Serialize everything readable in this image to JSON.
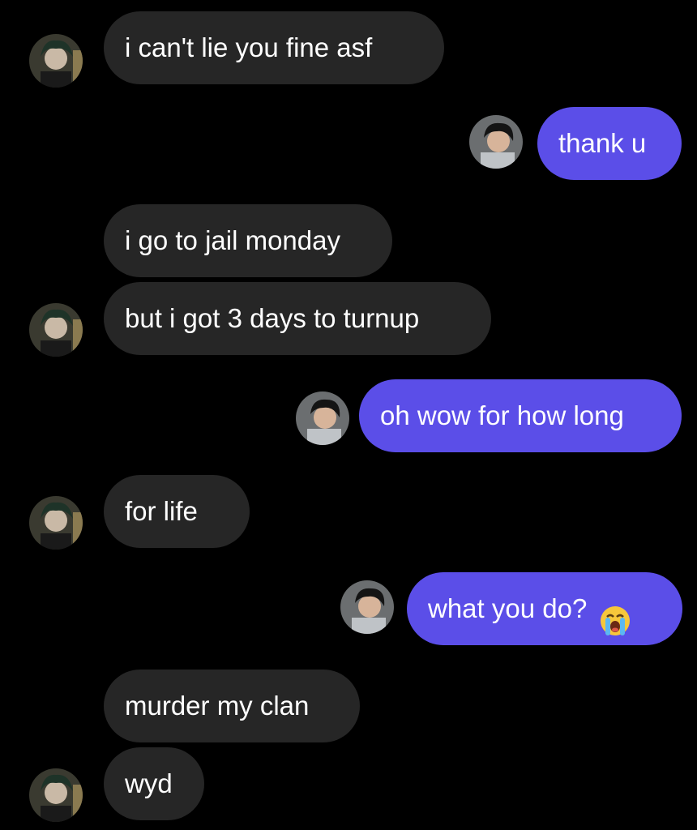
{
  "messages": [
    {
      "side": "in",
      "text": "i can't lie you fine asf"
    },
    {
      "side": "out",
      "text": "thank u"
    },
    {
      "side": "in",
      "text": "i go to jail monday"
    },
    {
      "side": "in",
      "text": "but i got 3 days to turnup"
    },
    {
      "side": "out",
      "text": "oh wow for how long"
    },
    {
      "side": "in",
      "text": "for life"
    },
    {
      "side": "out",
      "text": "what you do?",
      "emoji": "loudly-crying-face"
    },
    {
      "side": "in",
      "text": "murder my clan"
    },
    {
      "side": "in",
      "text": "wyd"
    }
  ],
  "colors": {
    "background": "#000000",
    "incoming_bubble": "#262626",
    "outgoing_bubble": "#5b4ee8",
    "text": "#ffffff"
  }
}
